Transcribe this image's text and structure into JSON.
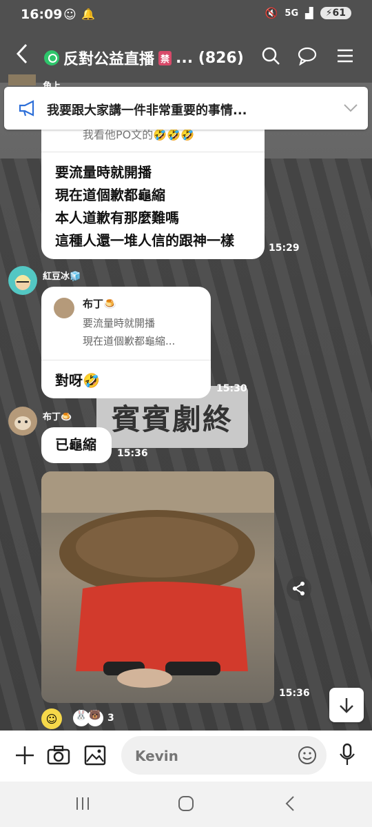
{
  "status": {
    "time": "16:09",
    "network": "5G",
    "battery": "61"
  },
  "header": {
    "back_icon": "chevron-left-icon",
    "title": "反對公益直播",
    "ban_badge": "禁",
    "title_suffix": "... (826)"
  },
  "announcement": {
    "text": "我要跟大家講一件非常重要的事情..."
  },
  "messages": {
    "top_partial_sender": "角上",
    "first": {
      "quote_partial": "我看他PO文的🤣🤣🤣",
      "lines": [
        "要流量時就開播",
        "現在道個歉都龜縮",
        "本人道歉有那麼難嗎",
        "這種人還一堆人信的跟神一樣"
      ],
      "time": "15:29"
    },
    "second": {
      "sender": "紅豆冰🧊",
      "reply_name": "布丁🍮",
      "reply_line1": "要流量時就開播",
      "reply_line2": "現在道個歉都龜縮...",
      "text": "對呀🤣",
      "time": "15:30"
    },
    "third": {
      "sender": "布丁🍮",
      "text": "已龜縮",
      "time": "15:36"
    },
    "image": {
      "time": "15:36",
      "share_icon": "share-icon"
    },
    "reactions": {
      "count": "3"
    }
  },
  "background": {
    "sign_text": "賓賓劇終"
  },
  "input": {
    "placeholder": "Kevin"
  }
}
